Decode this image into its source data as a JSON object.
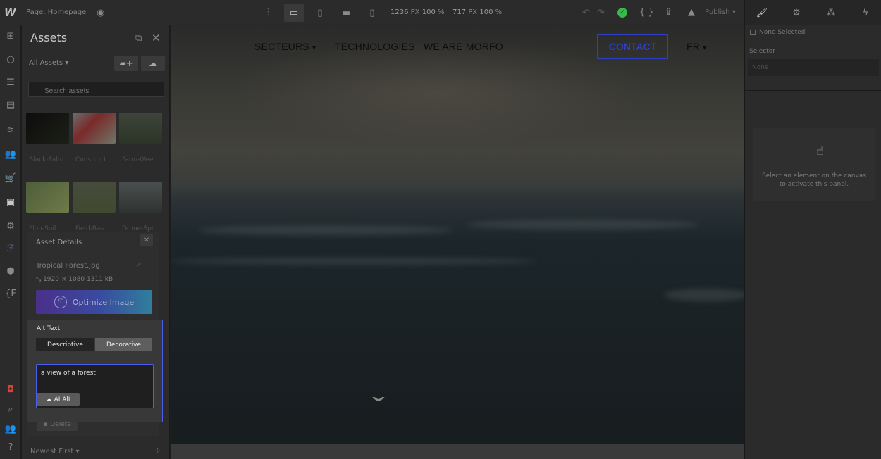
{
  "topbar": {
    "logo": "W",
    "page_label": "Page: Homepage",
    "width_value": "1236",
    "width_unit": "PX",
    "width_zoom": "100",
    "width_zoom_unit": "%",
    "height_value": "717",
    "height_unit": "PX",
    "height_zoom": "100",
    "height_zoom_unit": "%",
    "publish_label": "Publish"
  },
  "assets_panel": {
    "title": "Assets",
    "filter_label": "All Assets",
    "search_placeholder": "Search assets",
    "thumb_captions": [
      "Black-Palm",
      "Construct",
      "Farm-Wee",
      "Flou-Soil",
      "Field-Bas",
      "Drone-Spr"
    ],
    "sort_label": "Newest First"
  },
  "asset_details": {
    "title": "Asset Details",
    "file_name": "Tropical Forest.jpg",
    "dimensions": "1920 × 1080",
    "file_size": "1311 kB",
    "optimize_label": "Optimize Image",
    "delete_label": "Delete"
  },
  "alt_text": {
    "label": "Alt Text",
    "tab_descriptive": "Descriptive",
    "tab_decorative": "Decorative",
    "value": "a view of a forest",
    "ai_button": "AI Alt"
  },
  "site_nav": {
    "items": [
      "SECTEURS",
      "TECHNOLOGIES",
      "WE ARE MORFO"
    ],
    "contact_label": "CONTACT",
    "language": "FR"
  },
  "right_panel": {
    "none_selected": "None Selected",
    "selector_label": "Selector",
    "selector_placeholder": "None",
    "empty_message": "Select an element on the canvas to activate this panel."
  },
  "colors": {
    "accent_blue": "#4a5ef0",
    "contact_blue": "#2f3fc4",
    "success_green": "#3bb84b"
  }
}
